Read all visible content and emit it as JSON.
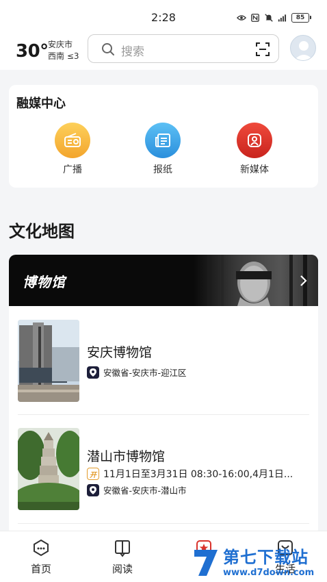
{
  "status_bar": {
    "time": "2:28",
    "battery": "85"
  },
  "header": {
    "temperature": "30°",
    "city": "安庆市",
    "wind": "西南 ≤3",
    "search_placeholder": "搜索"
  },
  "media_center": {
    "title": "融媒中心",
    "items": [
      {
        "label": "广播",
        "icon": "radio-icon",
        "color": "#f5b13a"
      },
      {
        "label": "报纸",
        "icon": "newspaper-icon",
        "color": "#3aa2e6"
      },
      {
        "label": "新媒体",
        "icon": "new-media-icon",
        "color": "#d9322b"
      }
    ]
  },
  "culture_map": {
    "title": "文化地图",
    "banner_title": "博物馆",
    "museums": [
      {
        "name": "安庆博物馆",
        "location": "安徽省-安庆市-迎江区",
        "hours": ""
      },
      {
        "name": "潜山市博物馆",
        "hours": "11月1日至3月31日 08:30-16:00,4月1日...",
        "hours_badge": "开",
        "location": "安徽省-安庆市-潜山市"
      }
    ]
  },
  "bottom_nav": {
    "items": [
      {
        "label": "首页",
        "icon": "home-icon"
      },
      {
        "label": "阅读",
        "icon": "book-icon"
      },
      {
        "label": "",
        "icon": "star-icon"
      },
      {
        "label": "生活",
        "icon": "life-icon"
      }
    ]
  },
  "watermark": {
    "main": "第七下载站",
    "url": "www.d7down.com"
  }
}
